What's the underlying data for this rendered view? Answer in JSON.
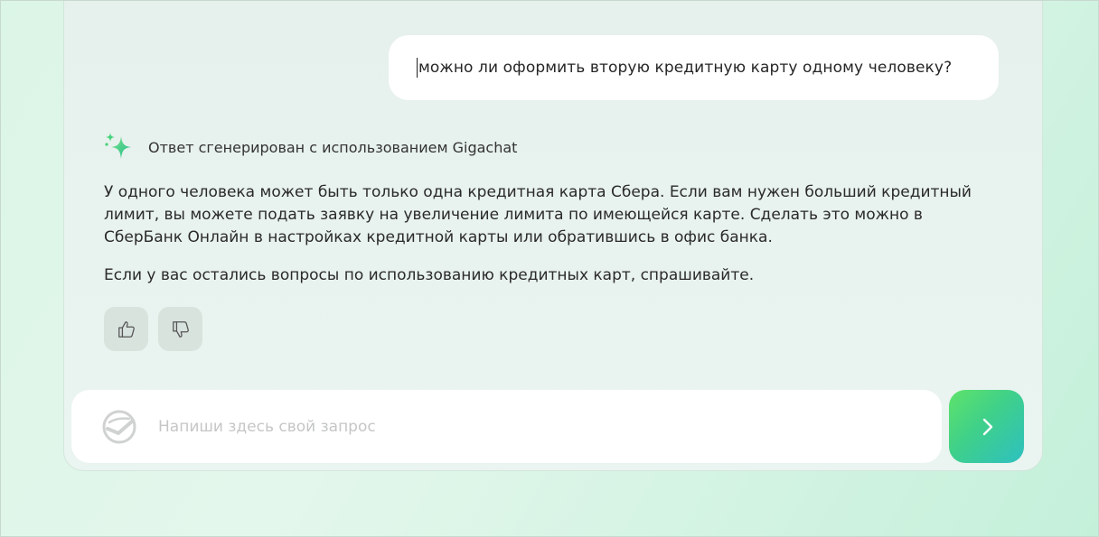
{
  "chat": {
    "user_message": "можно ли оформить вторую кредитную карту одному человеку?",
    "generated_note": "Ответ сгенерирован с использованием Gigachat",
    "answer_paragraphs": [
      "У одного человека может быть только одна кредитная карта Сбера. Если вам нужен больший кредитный лимит, вы можете подать заявку на увеличение лимита по имеющейся карте. Сделать это можно в СберБанк Онлайн в настройках кредитной карты или обратившись в офис банка.",
      "Если у вас остались вопросы по использованию кредитных карт, спрашивайте."
    ],
    "feedback": {
      "like_icon": "thumbs-up-icon",
      "dislike_icon": "thumbs-down-icon"
    }
  },
  "input": {
    "placeholder": "Напиши здесь свой запрос",
    "value": "",
    "logo_icon": "sber-logo-icon",
    "send_icon": "chevron-right-icon"
  },
  "colors": {
    "accent_gradient_start": "#5fe36a",
    "accent_gradient_end": "#2ec0c0",
    "sparkle": "#21c26b"
  }
}
